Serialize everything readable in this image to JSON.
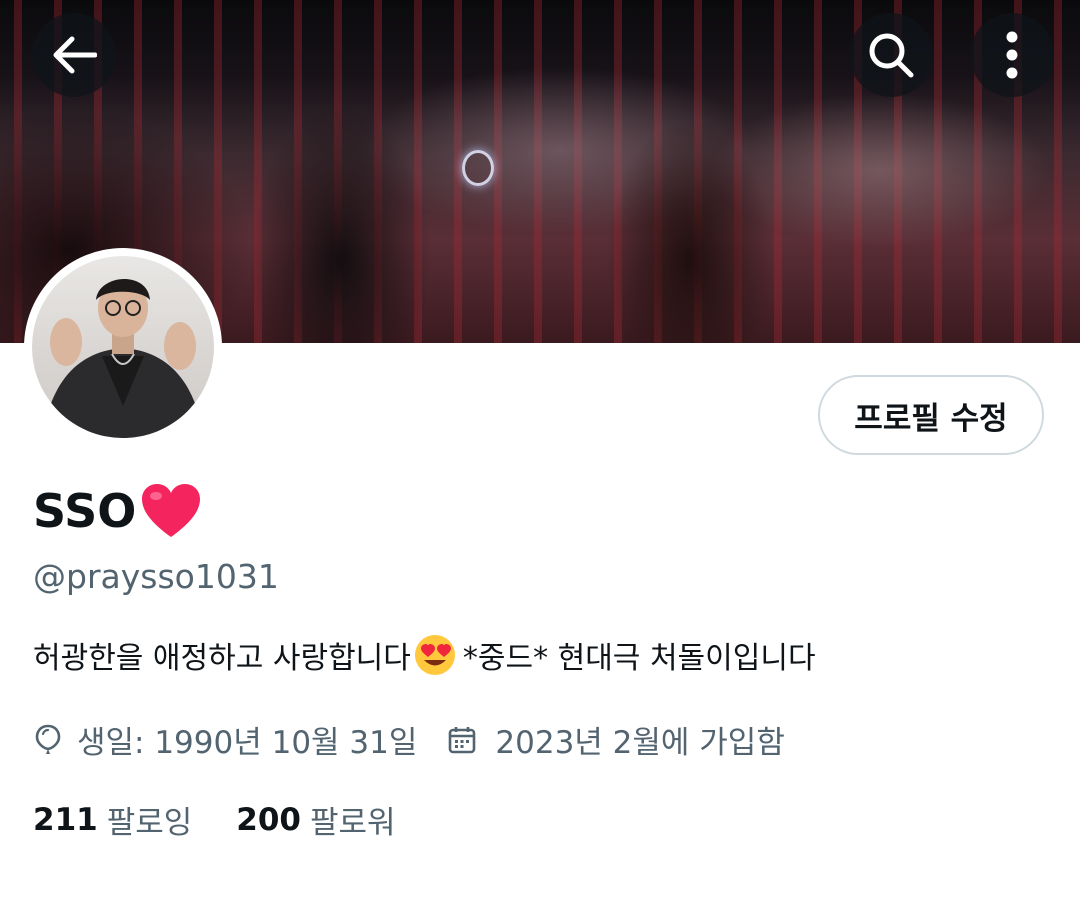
{
  "header": {
    "back_icon": "back-arrow-icon",
    "search_icon": "search-icon",
    "more_icon": "more-vertical-icon"
  },
  "profile": {
    "display_name": "SSO",
    "name_emoji": "❤️",
    "handle": "@praysso1031",
    "edit_button_label": "프로필 수정",
    "bio": {
      "text_before": "허광한을 애정하고 사랑합니다",
      "emoji": "😍",
      "text_after": " *중드* 현대극 처돌이입니다"
    },
    "birthday": "생일: 1990년 10월 31일",
    "joined": "2023년 2월에 가입함",
    "following_count": "211",
    "following_label": "팔로잉",
    "followers_count": "200",
    "followers_label": "팔로워"
  },
  "colors": {
    "text_primary": "#0f1419",
    "text_secondary": "#536471",
    "border": "#cfd9de",
    "heart": "#f4245e"
  }
}
